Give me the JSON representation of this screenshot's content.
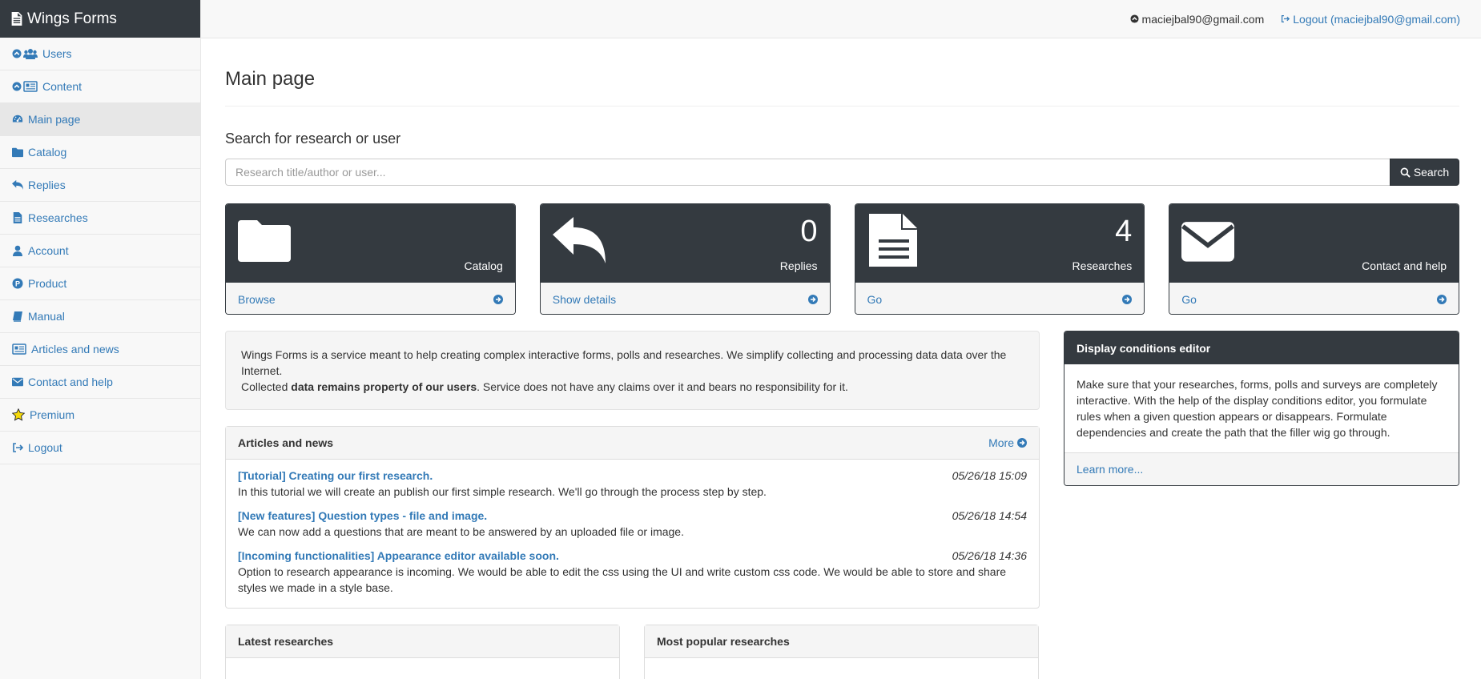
{
  "app": {
    "brand": "Wings Forms",
    "brand_icon": "file-icon"
  },
  "sidebar": {
    "items": [
      {
        "label": "Users",
        "icon": "users-icon",
        "expandable": true
      },
      {
        "label": "Content",
        "icon": "newspaper-icon",
        "expandable": true
      },
      {
        "label": "Main page",
        "icon": "dashboard-icon",
        "active": true
      },
      {
        "label": "Catalog",
        "icon": "folder-icon"
      },
      {
        "label": "Replies",
        "icon": "reply-icon"
      },
      {
        "label": "Researches",
        "icon": "file-text-icon"
      },
      {
        "label": "Account",
        "icon": "user-icon"
      },
      {
        "label": "Product",
        "icon": "product-icon"
      },
      {
        "label": "Manual",
        "icon": "book-icon"
      },
      {
        "label": "Articles and news",
        "icon": "newspaper-icon"
      },
      {
        "label": "Contact and help",
        "icon": "envelope-icon"
      },
      {
        "label": "Premium",
        "icon": "star-icon"
      },
      {
        "label": "Logout",
        "icon": "sign-out-icon"
      }
    ]
  },
  "topbar": {
    "email": "maciejbal90@gmail.com",
    "logout": "Logout (maciejbal90@gmail.com)"
  },
  "main": {
    "title": "Main page",
    "search_heading": "Search for research or user",
    "search_placeholder": "Research title/author or user...",
    "search_button": "Search"
  },
  "tiles": [
    {
      "icon": "folder-icon",
      "count": "",
      "label": "Catalog",
      "link": "Browse"
    },
    {
      "icon": "reply-icon",
      "count": "0",
      "label": "Replies",
      "link": "Show details"
    },
    {
      "icon": "file-text-icon",
      "count": "4",
      "label": "Researches",
      "link": "Go"
    },
    {
      "icon": "envelope-icon",
      "count": "",
      "label": "Contact and help",
      "link": "Go"
    }
  ],
  "intro": {
    "line1": "Wings Forms is a service meant to help creating complex interactive forms, polls and researches. We simplify collecting and processing data data over the Internet.",
    "line2_prefix": "Collected ",
    "line2_bold": "data remains property of our users",
    "line2_suffix": ". Service does not have any claims over it and bears no responsibility for it."
  },
  "articles": {
    "heading": "Articles and news",
    "more": "More",
    "items": [
      {
        "title": "[Tutorial] Creating our first research.",
        "date": "05/26/18 15:09",
        "text": "In this tutorial we will create an publish our first simple research. We'll go through the process step by step."
      },
      {
        "title": "[New features] Question types - file and image.",
        "date": "05/26/18 14:54",
        "text": "We can now add a questions that are meant to be answered by an uploaded file or image."
      },
      {
        "title": "[Incoming functionalities] Appearance editor available soon.",
        "date": "05/26/18 14:36",
        "text": "Option to research appearance is incoming. We would be able to edit the css using the UI and write custom css code. We would be able to store and share styles we made in a style base."
      }
    ]
  },
  "bottom_panels": {
    "latest": "Latest researches",
    "popular": "Most popular researches"
  },
  "editor": {
    "heading": "Display conditions editor",
    "body": "Make sure that your researches, forms, polls and surveys are completely interactive. With the help of the display conditions editor, you formulate rules when a given question appears or disappears. Formulate dependencies and create the path that the filler wig go through.",
    "link": "Learn more..."
  }
}
